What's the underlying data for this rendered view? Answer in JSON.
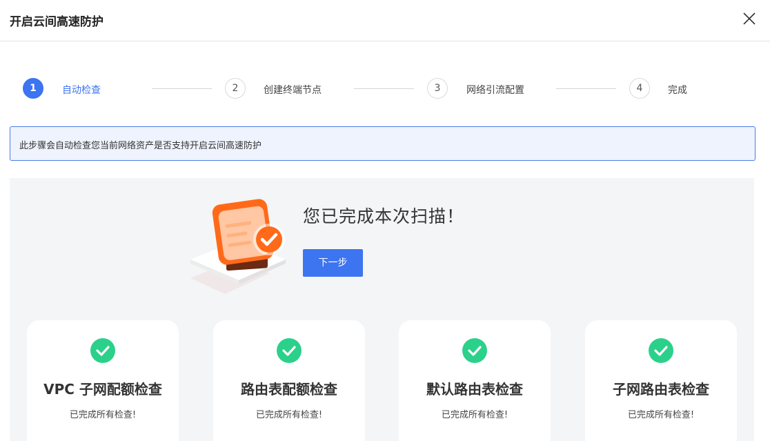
{
  "dialog": {
    "title": "开启云间高速防护"
  },
  "steps": [
    {
      "number": "1",
      "label": "自动检查",
      "active": true
    },
    {
      "number": "2",
      "label": "创建终端节点",
      "active": false
    },
    {
      "number": "3",
      "label": "网络引流配置",
      "active": false
    },
    {
      "number": "4",
      "label": "完成",
      "active": false
    }
  ],
  "info": {
    "text": "此步骤会自动检查您当前网络资产是否支持开启云间高速防护"
  },
  "result": {
    "title": "您已完成本次扫描！",
    "next_button": "下一步"
  },
  "cards": [
    {
      "title": "VPC 子网配额检查",
      "status": "已完成所有检查!"
    },
    {
      "title": "路由表配额检查",
      "status": "已完成所有检查!"
    },
    {
      "title": "默认路由表检查",
      "status": "已完成所有检查!"
    },
    {
      "title": "子网路由表检查",
      "status": "已完成所有检查!"
    }
  ],
  "colors": {
    "primary": "#3d74f0",
    "success": "#2bd18a",
    "accent_orange": "#ff6a1a",
    "panel_bg": "#f4f5f7"
  },
  "icons": {
    "close": "close-icon",
    "check": "check-circle-icon",
    "illustration": "scan-complete-illustration"
  }
}
